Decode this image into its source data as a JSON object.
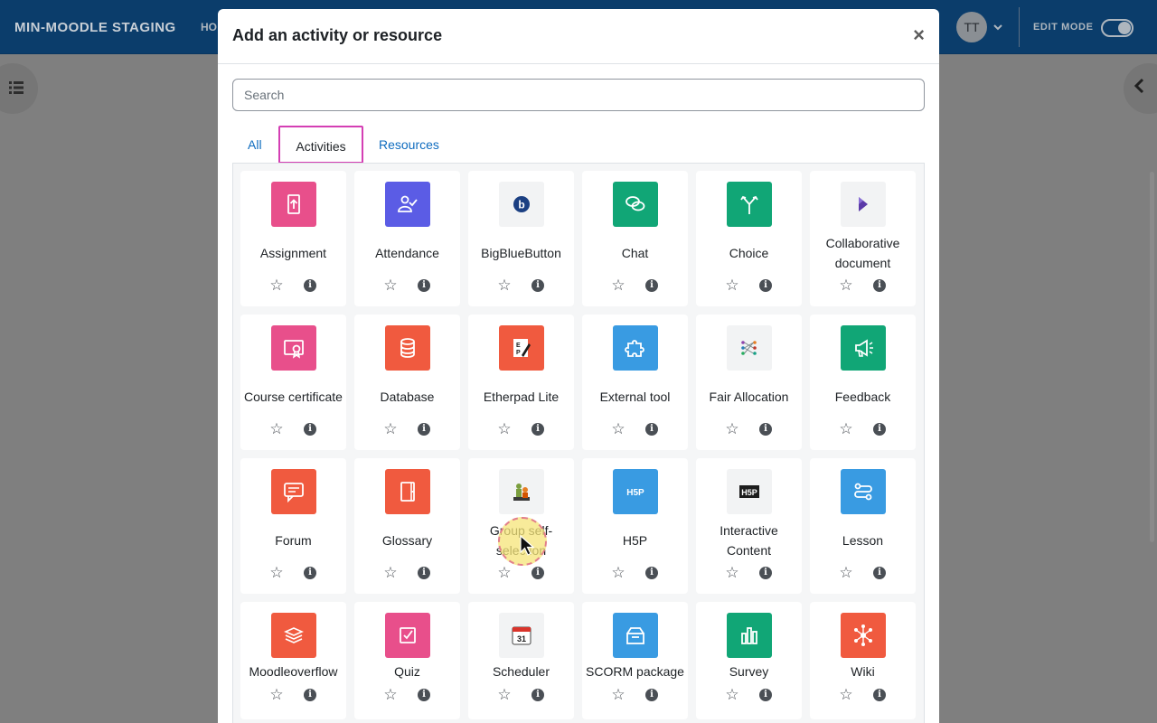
{
  "navbar": {
    "brand": "MIN-MOODLE STAGING",
    "home_partial": "HO",
    "avatar_initials": "TT",
    "edit_mode_label": "EDIT MODE"
  },
  "modal": {
    "title": "Add an activity or resource",
    "close_symbol": "×",
    "search_placeholder": "Search",
    "tabs": [
      {
        "label": "All",
        "selected": false
      },
      {
        "label": "Activities",
        "selected": true
      },
      {
        "label": "Resources",
        "selected": false
      }
    ],
    "items": [
      {
        "label": "Assignment",
        "icon": "assignment-icon",
        "color": "#e84f8b"
      },
      {
        "label": "Attendance",
        "icon": "attendance-icon",
        "color": "#5b5ce5"
      },
      {
        "label": "BigBlueButton",
        "icon": "bigbluebutton-icon",
        "color": "#f2f3f4"
      },
      {
        "label": "Chat",
        "icon": "chat-icon",
        "color": "#11a676"
      },
      {
        "label": "Choice",
        "icon": "choice-icon",
        "color": "#11a676"
      },
      {
        "label": "Collaborative document",
        "icon": "collaborative-document-icon",
        "color": "#f2f3f4"
      },
      {
        "label": "Course certificate",
        "icon": "certificate-icon",
        "color": "#e84f8b"
      },
      {
        "label": "Database",
        "icon": "database-icon",
        "color": "#f05a3f"
      },
      {
        "label": "Etherpad Lite",
        "icon": "etherpad-icon",
        "color": "#f05a3f"
      },
      {
        "label": "External tool",
        "icon": "puzzle-icon",
        "color": "#399be2"
      },
      {
        "label": "Fair Allocation",
        "icon": "fair-allocation-icon",
        "color": "#f2f3f4"
      },
      {
        "label": "Feedback",
        "icon": "megaphone-icon",
        "color": "#11a676"
      },
      {
        "label": "Forum",
        "icon": "forum-icon",
        "color": "#f05a3f"
      },
      {
        "label": "Glossary",
        "icon": "glossary-icon",
        "color": "#f05a3f"
      },
      {
        "label": "Group self-selection",
        "icon": "group-selection-icon",
        "color": "#f2f3f4"
      },
      {
        "label": "H5P",
        "icon": "h5p-icon",
        "color": "#399be2"
      },
      {
        "label": "Interactive Content",
        "icon": "h5p-dark-icon",
        "color": "#f2f3f4"
      },
      {
        "label": "Lesson",
        "icon": "lesson-icon",
        "color": "#399be2"
      },
      {
        "label": "Moodleoverflow",
        "icon": "moodleoverflow-icon",
        "color": "#f05a3f"
      },
      {
        "label": "Quiz",
        "icon": "quiz-icon",
        "color": "#e84f8b"
      },
      {
        "label": "Scheduler",
        "icon": "calendar-icon",
        "color": "#f2f3f4"
      },
      {
        "label": "SCORM package",
        "icon": "scorm-icon",
        "color": "#399be2"
      },
      {
        "label": "Survey",
        "icon": "survey-icon",
        "color": "#11a676"
      },
      {
        "label": "Wiki",
        "icon": "wiki-icon",
        "color": "#f05a3f"
      }
    ]
  },
  "colors": {
    "navbar": "#0b3d6b",
    "link": "#0f6cbf",
    "tab_highlight": "#d43fb4"
  }
}
